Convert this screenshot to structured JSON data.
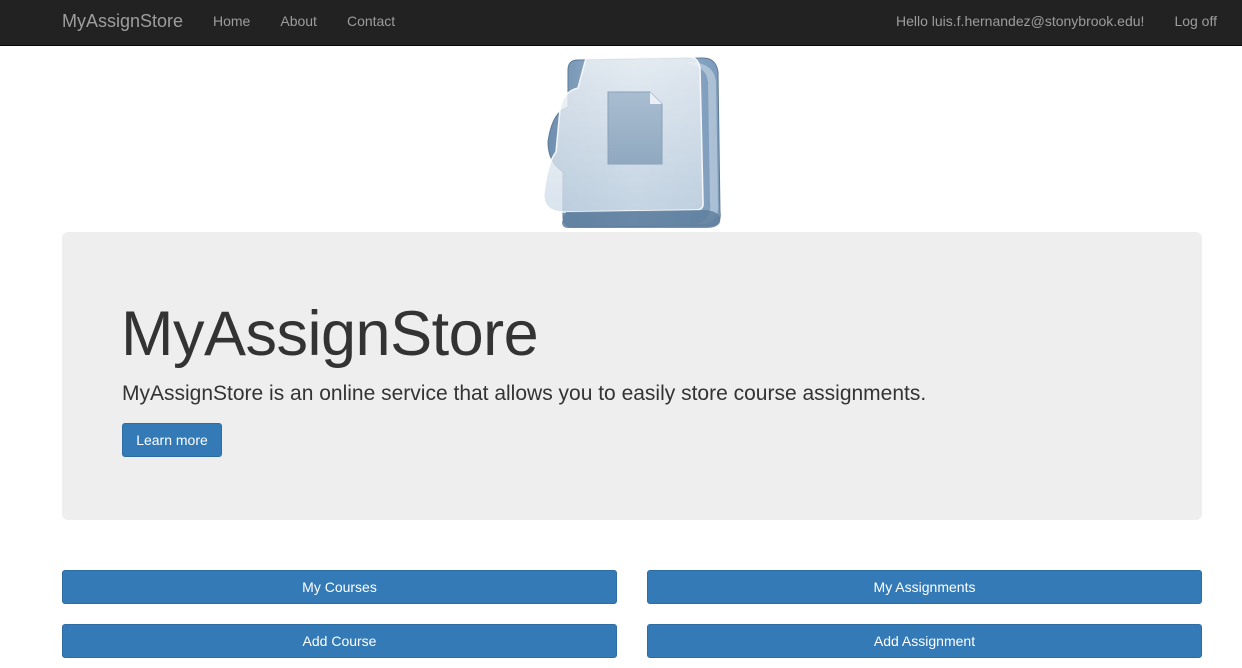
{
  "navbar": {
    "brand": "MyAssignStore",
    "links": [
      "Home",
      "About",
      "Contact"
    ],
    "greeting": "Hello luis.f.hernandez@stonybrook.edu!",
    "logoff": "Log off"
  },
  "logo": {
    "icon": "folder-document-icon"
  },
  "jumbotron": {
    "title": "MyAssignStore",
    "lead": "MyAssignStore is an online service that allows you to easily store course assignments.",
    "button": "Learn more"
  },
  "actions": {
    "my_courses": "My Courses",
    "my_assignments": "My Assignments",
    "add_course": "Add Course",
    "add_assignment": "Add Assignment"
  },
  "colors": {
    "navbar_bg": "#222222",
    "nav_text": "#9d9d9d",
    "jumbotron_bg": "#eeeeee",
    "primary": "#337ab7"
  }
}
